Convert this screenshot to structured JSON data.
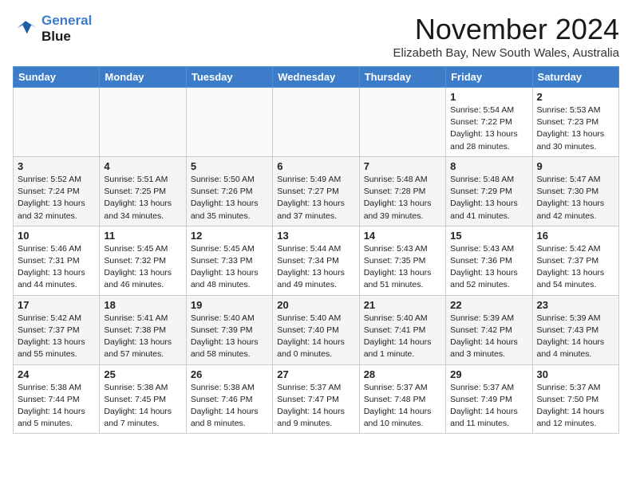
{
  "logo": {
    "line1": "General",
    "line2": "Blue"
  },
  "title": "November 2024",
  "subtitle": "Elizabeth Bay, New South Wales, Australia",
  "weekdays": [
    "Sunday",
    "Monday",
    "Tuesday",
    "Wednesday",
    "Thursday",
    "Friday",
    "Saturday"
  ],
  "weeks": [
    [
      {
        "day": "",
        "info": ""
      },
      {
        "day": "",
        "info": ""
      },
      {
        "day": "",
        "info": ""
      },
      {
        "day": "",
        "info": ""
      },
      {
        "day": "",
        "info": ""
      },
      {
        "day": "1",
        "info": "Sunrise: 5:54 AM\nSunset: 7:22 PM\nDaylight: 13 hours\nand 28 minutes."
      },
      {
        "day": "2",
        "info": "Sunrise: 5:53 AM\nSunset: 7:23 PM\nDaylight: 13 hours\nand 30 minutes."
      }
    ],
    [
      {
        "day": "3",
        "info": "Sunrise: 5:52 AM\nSunset: 7:24 PM\nDaylight: 13 hours\nand 32 minutes."
      },
      {
        "day": "4",
        "info": "Sunrise: 5:51 AM\nSunset: 7:25 PM\nDaylight: 13 hours\nand 34 minutes."
      },
      {
        "day": "5",
        "info": "Sunrise: 5:50 AM\nSunset: 7:26 PM\nDaylight: 13 hours\nand 35 minutes."
      },
      {
        "day": "6",
        "info": "Sunrise: 5:49 AM\nSunset: 7:27 PM\nDaylight: 13 hours\nand 37 minutes."
      },
      {
        "day": "7",
        "info": "Sunrise: 5:48 AM\nSunset: 7:28 PM\nDaylight: 13 hours\nand 39 minutes."
      },
      {
        "day": "8",
        "info": "Sunrise: 5:48 AM\nSunset: 7:29 PM\nDaylight: 13 hours\nand 41 minutes."
      },
      {
        "day": "9",
        "info": "Sunrise: 5:47 AM\nSunset: 7:30 PM\nDaylight: 13 hours\nand 42 minutes."
      }
    ],
    [
      {
        "day": "10",
        "info": "Sunrise: 5:46 AM\nSunset: 7:31 PM\nDaylight: 13 hours\nand 44 minutes."
      },
      {
        "day": "11",
        "info": "Sunrise: 5:45 AM\nSunset: 7:32 PM\nDaylight: 13 hours\nand 46 minutes."
      },
      {
        "day": "12",
        "info": "Sunrise: 5:45 AM\nSunset: 7:33 PM\nDaylight: 13 hours\nand 48 minutes."
      },
      {
        "day": "13",
        "info": "Sunrise: 5:44 AM\nSunset: 7:34 PM\nDaylight: 13 hours\nand 49 minutes."
      },
      {
        "day": "14",
        "info": "Sunrise: 5:43 AM\nSunset: 7:35 PM\nDaylight: 13 hours\nand 51 minutes."
      },
      {
        "day": "15",
        "info": "Sunrise: 5:43 AM\nSunset: 7:36 PM\nDaylight: 13 hours\nand 52 minutes."
      },
      {
        "day": "16",
        "info": "Sunrise: 5:42 AM\nSunset: 7:37 PM\nDaylight: 13 hours\nand 54 minutes."
      }
    ],
    [
      {
        "day": "17",
        "info": "Sunrise: 5:42 AM\nSunset: 7:37 PM\nDaylight: 13 hours\nand 55 minutes."
      },
      {
        "day": "18",
        "info": "Sunrise: 5:41 AM\nSunset: 7:38 PM\nDaylight: 13 hours\nand 57 minutes."
      },
      {
        "day": "19",
        "info": "Sunrise: 5:40 AM\nSunset: 7:39 PM\nDaylight: 13 hours\nand 58 minutes."
      },
      {
        "day": "20",
        "info": "Sunrise: 5:40 AM\nSunset: 7:40 PM\nDaylight: 14 hours\nand 0 minutes."
      },
      {
        "day": "21",
        "info": "Sunrise: 5:40 AM\nSunset: 7:41 PM\nDaylight: 14 hours\nand 1 minute."
      },
      {
        "day": "22",
        "info": "Sunrise: 5:39 AM\nSunset: 7:42 PM\nDaylight: 14 hours\nand 3 minutes."
      },
      {
        "day": "23",
        "info": "Sunrise: 5:39 AM\nSunset: 7:43 PM\nDaylight: 14 hours\nand 4 minutes."
      }
    ],
    [
      {
        "day": "24",
        "info": "Sunrise: 5:38 AM\nSunset: 7:44 PM\nDaylight: 14 hours\nand 5 minutes."
      },
      {
        "day": "25",
        "info": "Sunrise: 5:38 AM\nSunset: 7:45 PM\nDaylight: 14 hours\nand 7 minutes."
      },
      {
        "day": "26",
        "info": "Sunrise: 5:38 AM\nSunset: 7:46 PM\nDaylight: 14 hours\nand 8 minutes."
      },
      {
        "day": "27",
        "info": "Sunrise: 5:37 AM\nSunset: 7:47 PM\nDaylight: 14 hours\nand 9 minutes."
      },
      {
        "day": "28",
        "info": "Sunrise: 5:37 AM\nSunset: 7:48 PM\nDaylight: 14 hours\nand 10 minutes."
      },
      {
        "day": "29",
        "info": "Sunrise: 5:37 AM\nSunset: 7:49 PM\nDaylight: 14 hours\nand 11 minutes."
      },
      {
        "day": "30",
        "info": "Sunrise: 5:37 AM\nSunset: 7:50 PM\nDaylight: 14 hours\nand 12 minutes."
      }
    ]
  ]
}
